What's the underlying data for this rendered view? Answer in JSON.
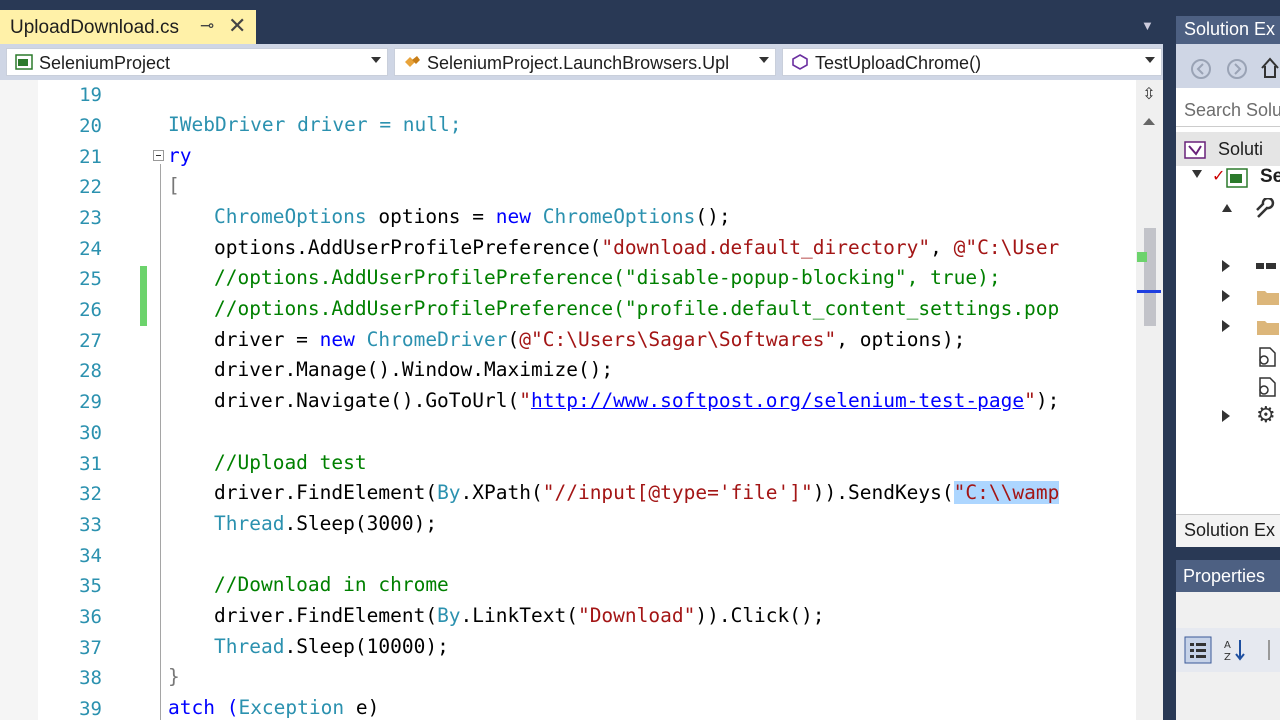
{
  "tab": {
    "title": "UploadDownload.cs",
    "pin_glyph": "⊸",
    "close_glyph": "✕"
  },
  "nav": {
    "project": "SeleniumProject",
    "class": "SeleniumProject.LaunchBrowsers.Upl",
    "member": "TestUploadChrome()"
  },
  "editor": {
    "lines": [
      "19",
      "20",
      "21",
      "22",
      "23",
      "24",
      "25",
      "26",
      "27",
      "28",
      "29",
      "30",
      "31",
      "32",
      "33",
      "34",
      "35",
      "36",
      "37",
      "38",
      "39"
    ]
  },
  "code": {
    "l20": "IWebDriver driver = null;",
    "l21": "ry",
    "l23_type": "ChromeOptions",
    "l23_mid": " options = ",
    "l23_new": "new",
    "l23_type2": "ChromeOptions",
    "l23_end": "();",
    "l24_a": "options.AddUserProfilePreference(",
    "l24_s1": "\"download.default_directory\"",
    "l24_b": ", ",
    "l24_s2": "@\"C:\\User",
    "l25": "//options.AddUserProfilePreference(\"disable-popup-blocking\", true);",
    "l26": "//options.AddUserProfilePreference(\"profile.default_content_settings.pop",
    "l27_a": "driver = ",
    "l27_new": "new",
    "l27_type": "ChromeDriver",
    "l27_b": "(",
    "l27_s": "@\"C:\\Users\\Sagar\\Softwares\"",
    "l27_c": ", options);",
    "l28": "driver.Manage().Window.Maximize();",
    "l29_a": "driver.Navigate().GoToUrl(",
    "l29_q1": "\"",
    "l29_url": "http://www.softpost.org/selenium-test-page",
    "l29_q2": "\"",
    "l29_b": ");",
    "l31": "//Upload test",
    "l32_a": "driver.FindElement(",
    "l32_by": "By",
    "l32_b": ".XPath(",
    "l32_s": "\"//input[@type='file']\"",
    "l32_c": ")).SendKeys(",
    "l32_sel": "\"C:\\\\wamp",
    "l33_type": "Thread",
    "l33_b": ".Sleep(3000);",
    "l35": "//Download in chrome",
    "l36_a": "driver.FindElement(",
    "l36_by": "By",
    "l36_b": ".LinkText(",
    "l36_s": "\"Download\"",
    "l36_c": ")).Click();",
    "l37_type": "Thread",
    "l37_b": ".Sleep(10000);",
    "l39_a": "atch (",
    "l39_type": "Exception",
    "l39_b": " e)"
  },
  "solution_explorer": {
    "title": "Solution Ex",
    "search_placeholder": "Search Solu",
    "root_label": "Soluti",
    "project_label": "Se",
    "footer_tab": "Solution Ex"
  },
  "properties": {
    "title": "Properties"
  },
  "colors": {
    "keyword": "#0000ff",
    "type": "#2b91af",
    "string": "#a31515",
    "comment": "#008000",
    "tab_active": "#fff1a8"
  }
}
